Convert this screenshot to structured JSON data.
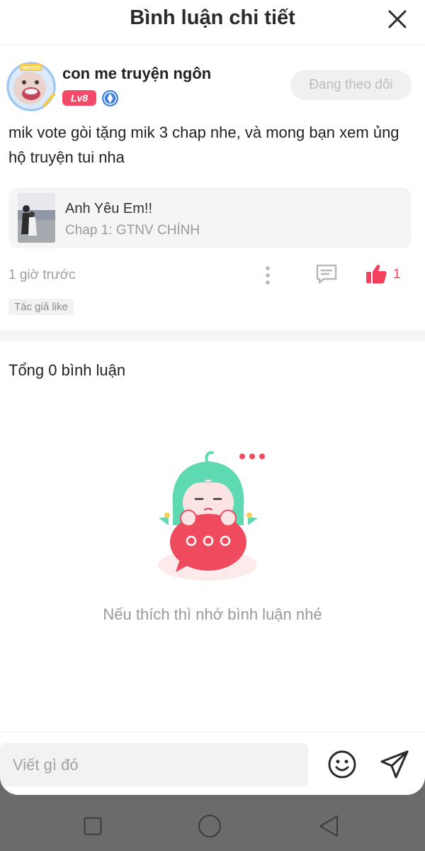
{
  "header": {
    "title": "Bình luận chi tiết"
  },
  "comment": {
    "username": "con me truyện ngôn",
    "level_badge": "Lv8",
    "avatar_badge": "WRITER",
    "follow_label": "Đang theo dõi",
    "text": "mik vote gòi tặng mik 3 chap nhe, và mong bạn xem ủng hộ truyện tui nha",
    "story": {
      "title": "Anh Yêu Em!!",
      "chapter": "Chap 1: GTNV CHÍNH"
    },
    "time": "1 giờ trước",
    "like_count": "1",
    "author_tag": "Tác giả like"
  },
  "replies": {
    "total_label": "Tổng 0 bình luận",
    "empty_text": "Nếu thích thì nhớ bình luận nhé"
  },
  "input": {
    "placeholder": "Viết gì đó"
  },
  "colors": {
    "accent": "#f4405e",
    "badge": "#f44a6a",
    "mascot_hair": "#5fd9b2",
    "bubble": "#ef4a5e"
  },
  "icons": [
    "close-icon",
    "verified-icon",
    "more-icon",
    "reply-icon",
    "thumbs-up-icon",
    "emoji-icon",
    "send-icon",
    "nav-square-icon",
    "nav-home-icon",
    "nav-back-icon"
  ]
}
